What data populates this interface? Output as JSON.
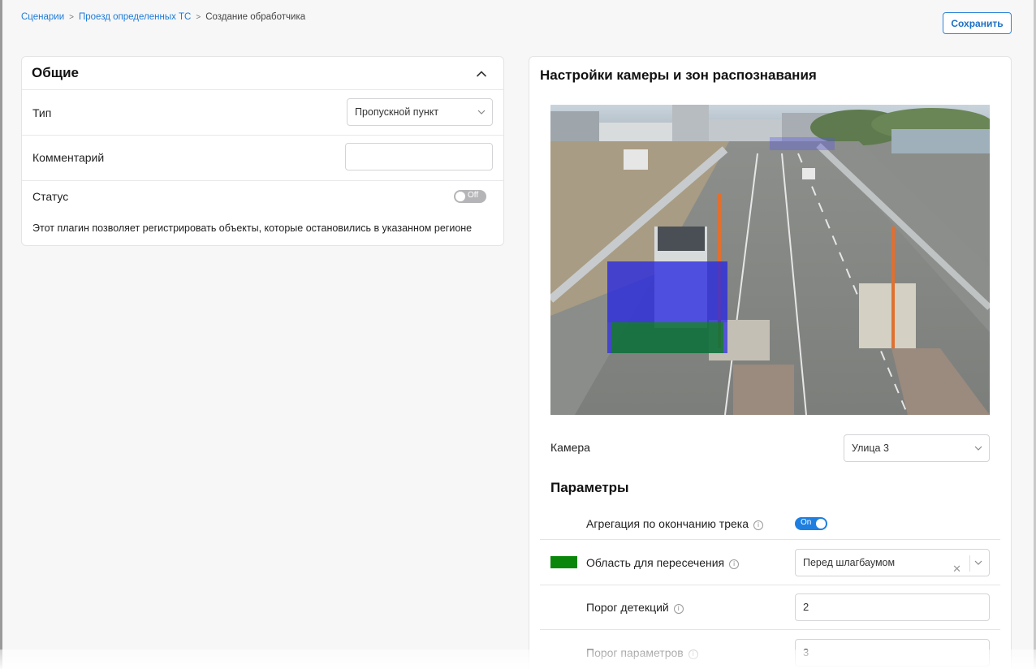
{
  "breadcrumb": {
    "items": [
      "Сценарии",
      "Проезд определенных ТС"
    ],
    "current": "Создание обработчика",
    "separator": ">"
  },
  "save_label": "Сохранить",
  "general": {
    "title": "Общие",
    "type_label": "Тип",
    "type_value": "Пропускной пункт",
    "comment_label": "Комментарий",
    "comment_value": "",
    "status_label": "Статус",
    "status_toggle": "Off",
    "description": "Этот плагин позволяет регистрировать объекты, которые остановились в указанном регионе"
  },
  "camera_settings": {
    "title": "Настройки камеры и зон распознавания",
    "camera_label": "Камера",
    "camera_value": "Улица 3"
  },
  "params": {
    "title": "Параметры",
    "aggregation_label": "Агрегация по окончанию трека",
    "aggregation_toggle": "On",
    "area_label": "Область для пересечения",
    "area_value": "Перед шлагбаумом",
    "area_color": "#0a870a",
    "clear_glyph": "✕",
    "detect_threshold_label": "Порог детекций",
    "detect_threshold_value": "2",
    "params_threshold_label": "Порог параметров",
    "params_threshold_value": "3",
    "info_glyph": "i"
  },
  "colors": {
    "accent": "#1e7fe0",
    "link": "#1e7bd6",
    "zone_blue": "#2a2ae0",
    "zone_green": "#0a870a"
  }
}
